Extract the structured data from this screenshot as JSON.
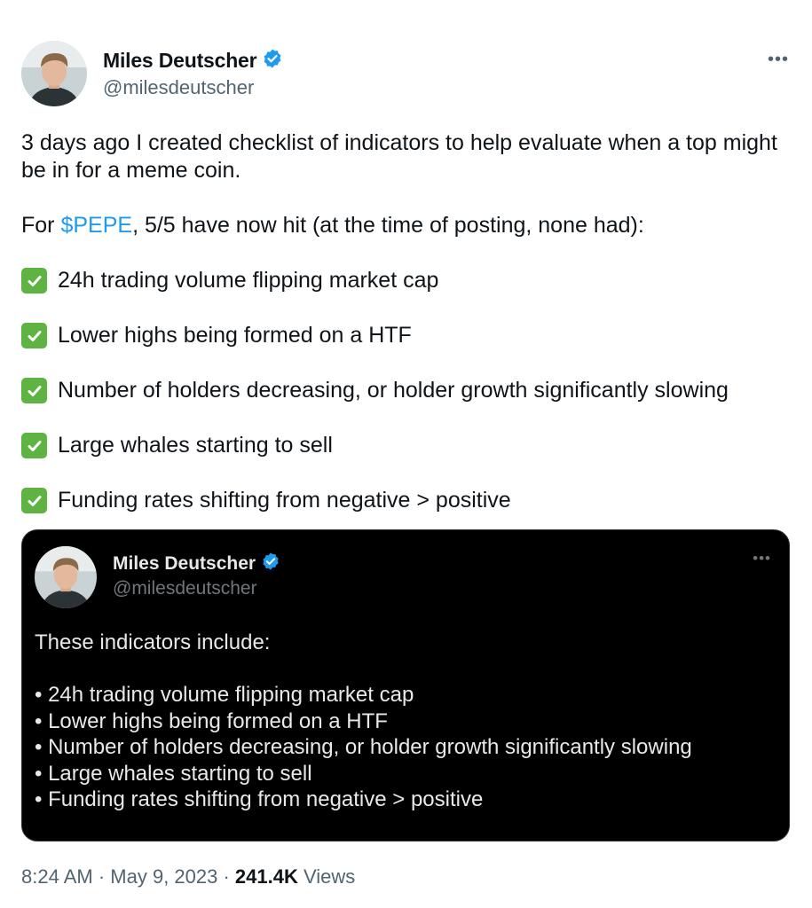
{
  "author": {
    "name": "Miles Deutscher",
    "handle": "@milesdeutscher",
    "verified_icon": "verified-badge",
    "verified_color": "#1d9bf0"
  },
  "more_icon": "more-dots-icon",
  "tweet": {
    "intro": "3 days ago I created checklist of indicators to help evaluate when a top might be in for a meme coin.",
    "for_prefix": "For ",
    "cashtag": "$PEPE",
    "for_suffix": ", 5/5 have now hit (at the time of posting, none had):",
    "checklist": [
      "24h trading volume flipping market cap",
      "Lower highs being formed on a HTF",
      "Number of holders decreasing, or holder growth significantly slowing",
      "Large whales starting to sell",
      "Funding rates shifting from negative > positive"
    ],
    "check_icon": "check-mark-box-icon",
    "check_color": "#5eb342"
  },
  "quote": {
    "name": "Miles Deutscher",
    "handle": "@milesdeutscher",
    "intro": "These indicators include:",
    "bullets": [
      "• 24h trading volume flipping market cap",
      "• Lower highs being formed on a HTF",
      "• Number of holders decreasing, or holder growth significantly slowing",
      "• Large whales starting to sell",
      "• Funding rates shifting from negative > positive"
    ],
    "background": "#000000"
  },
  "meta": {
    "time": "8:24 AM",
    "separator": " · ",
    "date": "May 9, 2023",
    "views_count": "241.4K",
    "views_label": " Views"
  }
}
